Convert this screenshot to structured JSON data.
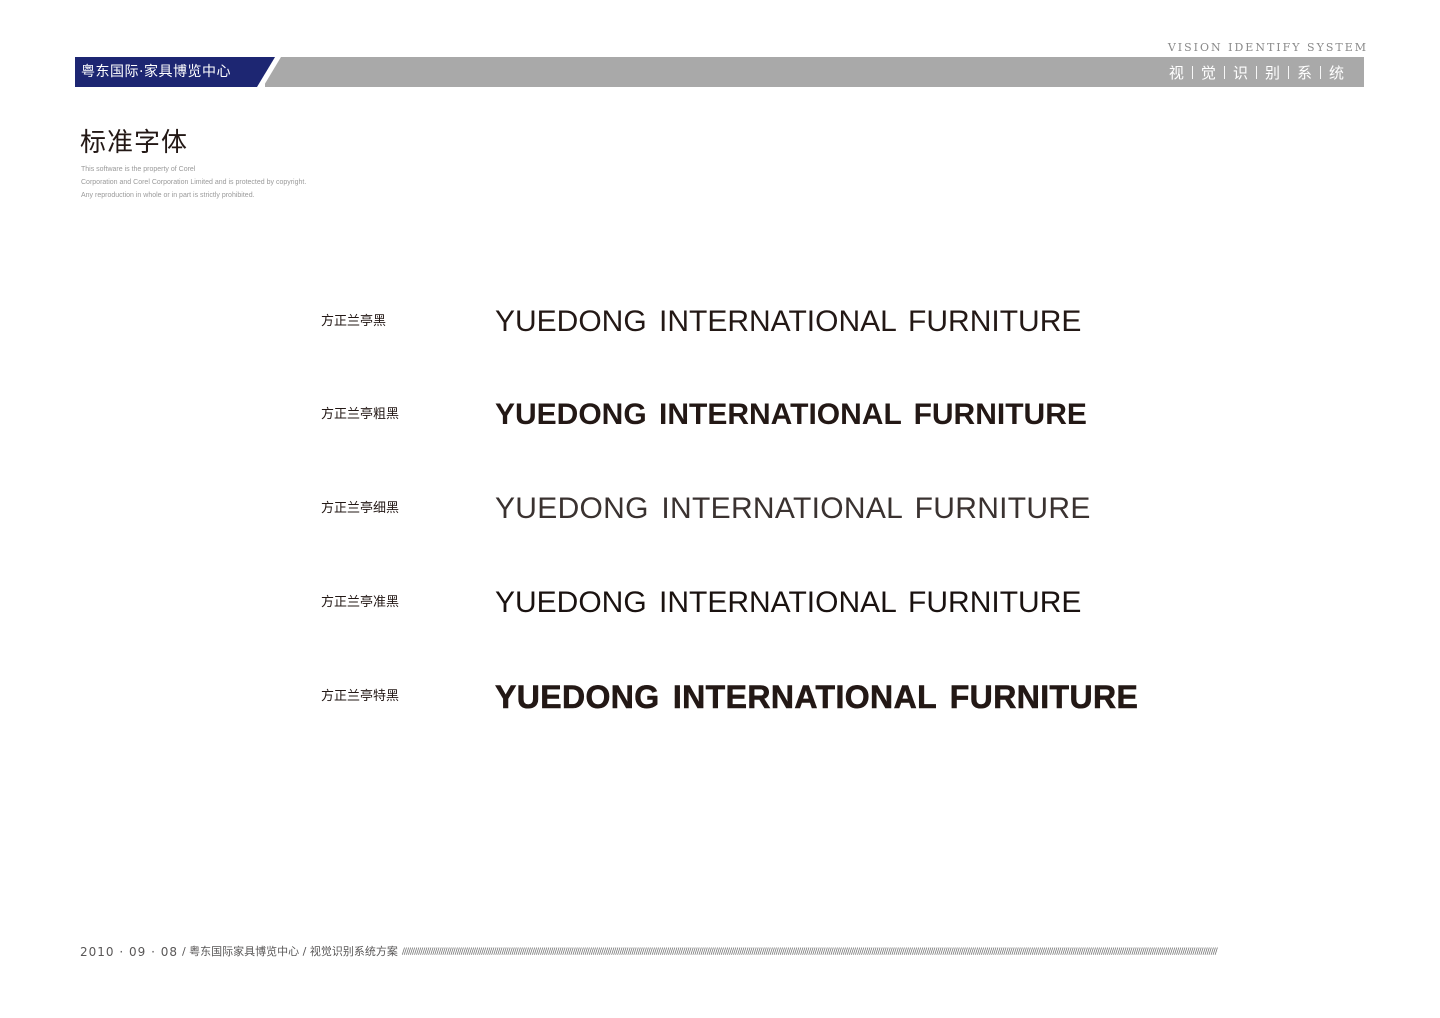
{
  "header": {
    "vision_label": "VISION IDENTIFY SYSTEM",
    "brand_name": "粤东国际·家具博览中心",
    "vi_chars": [
      "视",
      "觉",
      "识",
      "别",
      "系",
      "统"
    ],
    "colors": {
      "brand_block": "#1d2672",
      "bar": "#a9a9a9"
    }
  },
  "page": {
    "title": "标准字体",
    "notice": [
      "This software is the property of Corel",
      "Corporation and Corel Corporation Limited and is protected by copyright.",
      "Any reproduction in whole or in part is strictly prohibited."
    ]
  },
  "fonts": [
    {
      "name": "方正兰亭黑",
      "sample": "YUEDONG INTERNATIONAL FURNITURE"
    },
    {
      "name": "方正兰亭粗黑",
      "sample": "YUEDONG INTERNATIONAL FURNITURE"
    },
    {
      "name": "方正兰亭细黑",
      "sample": "YUEDONG INTERNATIONAL FURNITURE"
    },
    {
      "name": "方正兰亭准黑",
      "sample": "YUEDONG INTERNATIONAL FURNITURE"
    },
    {
      "name": "方正兰亭特黑",
      "sample": "YUEDONG INTERNATIONAL FURNITURE"
    }
  ],
  "footer": {
    "date": "2010 · 09 · 08",
    "path": "/ 粤东国际家具博览中心 / 视觉识别系统方案",
    "slashes": "/////////////////////////////////////////////////////////////////////////////////////////////////////////////////////////////////////////////////////////////////////////////////////////////////////////////////////////////////////////////////////////////////////////////////////////////////////////////////////////////////////////////////////////////////////////////////////////////////////////////////"
  }
}
